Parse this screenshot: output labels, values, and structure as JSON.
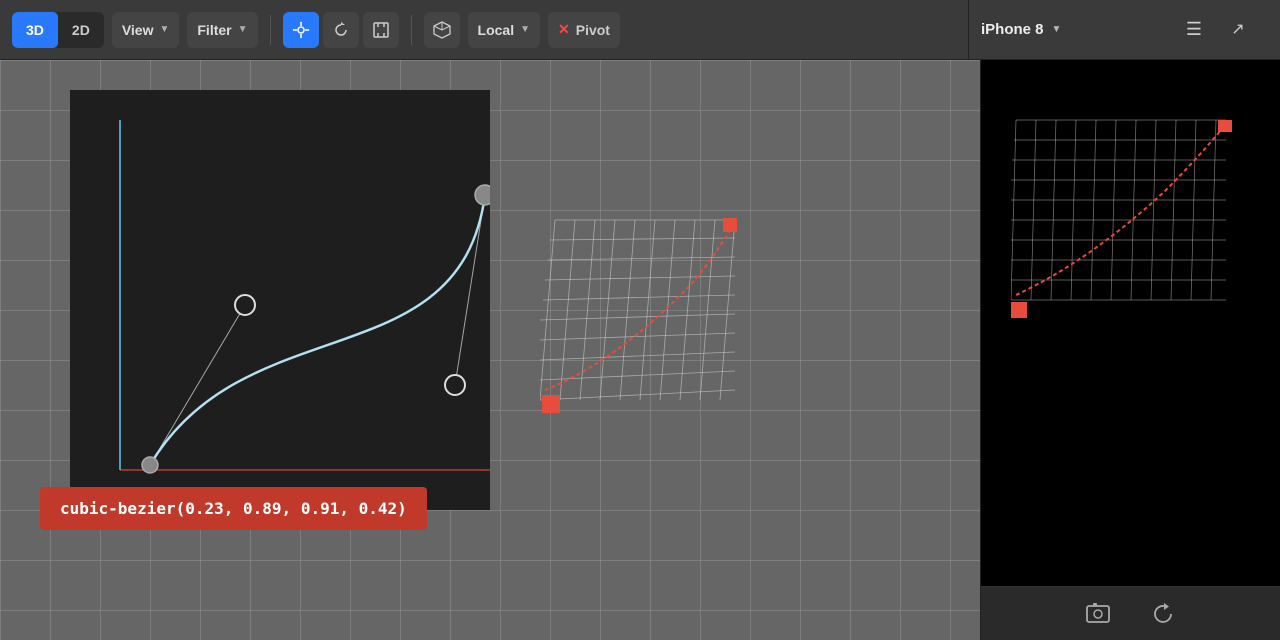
{
  "toolbar": {
    "btn_3d": "3D",
    "btn_2d": "2D",
    "view_label": "View",
    "filter_label": "Filter",
    "local_label": "Local",
    "pivot_label": "Pivot",
    "iphone_label": "iPhone 8",
    "move_icon": "⊕",
    "refresh_icon": "↺",
    "frame_icon": "▣",
    "cube_icon": "⬡"
  },
  "bezier": {
    "formula": "cubic-bezier(0.23, 0.89, 0.91, 0.42)"
  },
  "right_panel": {
    "device": "iPhone 8",
    "screenshot_icon": "📷",
    "back_icon": "↩"
  }
}
